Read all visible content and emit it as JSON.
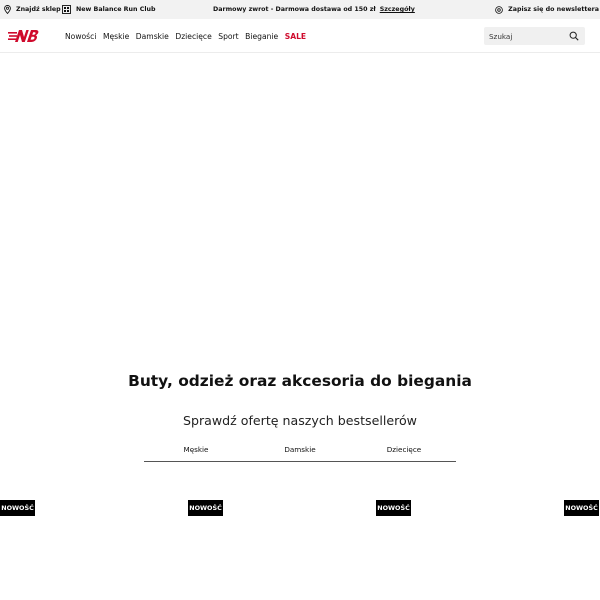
{
  "topbar": {
    "store_label": "Znajdź sklep",
    "run_club_label": "New Balance Run Club",
    "promo_text": "Darmowy zwrot - Darmowa dostawa od 150 zł",
    "promo_link": "Szczegóły",
    "newsletter_label": "Zapisz się do newslettera",
    "icons": {
      "store": "location-pin-icon",
      "club": "run-club-icon",
      "newsletter": "at-sign-icon"
    }
  },
  "header": {
    "logo_name": "new-balance-logo",
    "brand_color": "#cf0a2c",
    "nav": [
      {
        "label": "Nowości"
      },
      {
        "label": "Męskie"
      },
      {
        "label": "Damskie"
      },
      {
        "label": "Dziecięce"
      },
      {
        "label": "Sport"
      },
      {
        "label": "Bieganie"
      },
      {
        "label": "SALE"
      }
    ],
    "search": {
      "placeholder": "Szukaj",
      "icon": "search-icon"
    }
  },
  "main": {
    "headline": "Buty, odzież oraz akcesoria do biegania",
    "subline": "Sprawdź ofertę naszych bestsellerów",
    "tabs": [
      {
        "label": "Męskie"
      },
      {
        "label": "Damskie"
      },
      {
        "label": "Dziecięce"
      }
    ],
    "badges": [
      "NOWOŚĆ",
      "NOWOŚĆ",
      "NOWOŚĆ",
      "NOWOŚĆ"
    ]
  }
}
